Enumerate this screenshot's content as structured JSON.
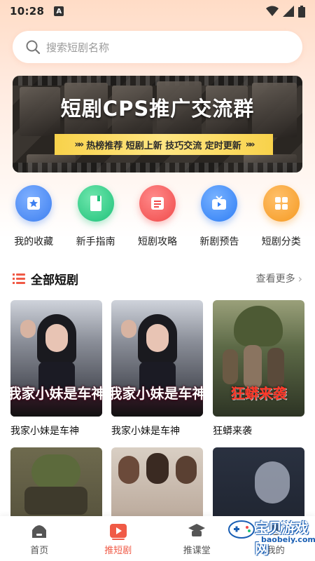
{
  "status_bar": {
    "time": "10:28",
    "notification": "A"
  },
  "search": {
    "placeholder": "搜索短剧名称"
  },
  "banner": {
    "title": "短剧CPS推广交流群",
    "ribbon": "热榜推荐 短剧上新 技巧交流 定时更新",
    "ribbon_chevrons": "»»"
  },
  "quick_nav": [
    {
      "label": "我的收藏",
      "icon": "star-icon",
      "color": "#3d7ff0"
    },
    {
      "label": "新手指南",
      "icon": "book-icon",
      "color": "#1fc27a"
    },
    {
      "label": "短剧攻略",
      "icon": "list-doc-icon",
      "color": "#f04a4a"
    },
    {
      "label": "新剧预告",
      "icon": "tv-play-icon",
      "color": "#2f7ef5"
    },
    {
      "label": "短剧分类",
      "icon": "grid-icon",
      "color": "#f59a22"
    }
  ],
  "section": {
    "title": "全部短剧",
    "more": "查看更多",
    "more_arrow": "›"
  },
  "dramas": [
    {
      "name": "我家小妹是车神",
      "poster_text": "我家小妹是车神"
    },
    {
      "name": "我家小妹是车神",
      "poster_text": "我家小妹是车神"
    },
    {
      "name": "狂蟒来袭",
      "poster_text": "狂蟒来袭"
    },
    {
      "name": "",
      "poster_text": ""
    },
    {
      "name": "",
      "poster_text": ""
    },
    {
      "name": "",
      "poster_text": ""
    }
  ],
  "tabs": [
    {
      "label": "首页",
      "icon": "home-icon"
    },
    {
      "label": "推短剧",
      "icon": "play-icon",
      "active": true
    },
    {
      "label": "推课堂",
      "icon": "classroom-icon"
    },
    {
      "label": "我的",
      "icon": "profile-icon"
    }
  ],
  "watermark": {
    "text": "宝贝游戏网",
    "url": "baobeiy.com"
  },
  "colors": {
    "accent": "#f05a46",
    "ribbon": "#f8d24b"
  }
}
